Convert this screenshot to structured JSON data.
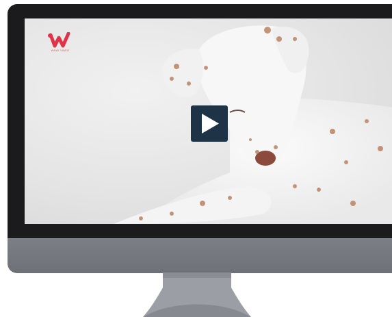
{
  "video": {
    "logo_text": "WAYE VIDEO",
    "play_icon": "play-icon"
  },
  "colors": {
    "bezel": "#1b1b1d",
    "chin": "#74787e",
    "play_button": "#1f3347",
    "logo_red": "#e0334a"
  }
}
